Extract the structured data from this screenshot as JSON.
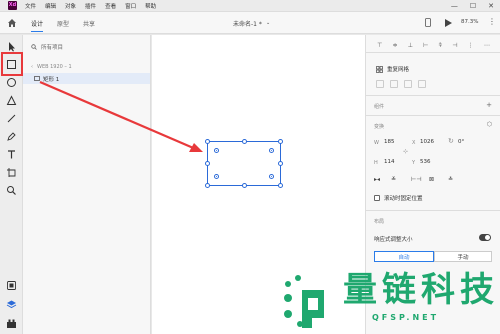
{
  "app": {
    "logo_text": "Xd",
    "title": "未命名-1 *"
  },
  "menu": [
    "文件",
    "编辑",
    "对象",
    "插件",
    "查看",
    "窗口",
    "帮助"
  ],
  "window_controls": [
    "—",
    "☐",
    "✕"
  ],
  "modes": [
    "设计",
    "原型",
    "共享"
  ],
  "zoom": "87.3%",
  "layers": {
    "search_placeholder": "所有项目",
    "crumb": "WEB 1920 – 1",
    "item": "矩形 1"
  },
  "props": {
    "repeat_grid": "重复网格",
    "components": "组件",
    "transform": "变换",
    "w_label": "W",
    "w": "185",
    "x_label": "X",
    "x": "1026",
    "rotation": "0°",
    "h_label": "H",
    "h": "114",
    "y_label": "Y",
    "y": "536",
    "fix_position": "滚动时固定位置",
    "layout": "布局",
    "responsive": "响应式调整大小",
    "auto": "自动",
    "manual": "手动"
  },
  "watermark": {
    "title": "量链科技",
    "url": "QFSP.NET"
  },
  "colors": {
    "accent": "#2b7ce9",
    "highlight": "#e8393b",
    "watermark": "#1fa86f"
  }
}
